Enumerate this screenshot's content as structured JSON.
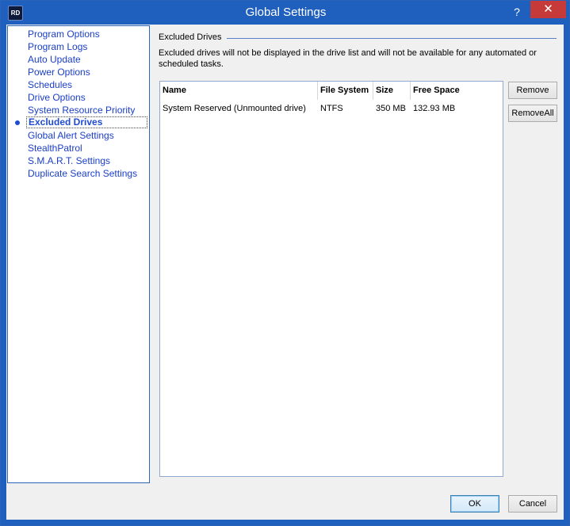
{
  "window": {
    "title": "Global Settings",
    "app_icon_text": "RD",
    "help_glyph": "?",
    "close_glyph": "✕"
  },
  "sidebar": {
    "items": [
      {
        "label": "Program Options",
        "selected": false
      },
      {
        "label": "Program Logs",
        "selected": false
      },
      {
        "label": "Auto Update",
        "selected": false
      },
      {
        "label": "Power Options",
        "selected": false
      },
      {
        "label": "Schedules",
        "selected": false
      },
      {
        "label": "Drive Options",
        "selected": false
      },
      {
        "label": "System Resource Priority",
        "selected": false
      },
      {
        "label": "Excluded Drives",
        "selected": true
      },
      {
        "label": "Global Alert Settings",
        "selected": false
      },
      {
        "label": "StealthPatrol",
        "selected": false
      },
      {
        "label": "S.M.A.R.T. Settings",
        "selected": false
      },
      {
        "label": "Duplicate Search Settings",
        "selected": false
      }
    ]
  },
  "panel": {
    "group_title": "Excluded Drives",
    "description": "Excluded drives will not be displayed in the drive list and will not be available for any automated or scheduled tasks.",
    "columns": [
      "Name",
      "File System",
      "Size",
      "Free Space"
    ],
    "rows": [
      {
        "name": "System Reserved (Unmounted drive)",
        "file_system": "NTFS",
        "size": "350 MB",
        "free_space": "132.93 MB"
      }
    ],
    "remove_label": "Remove",
    "remove_all_label": "RemoveAll"
  },
  "footer": {
    "ok_label": "OK",
    "cancel_label": "Cancel"
  },
  "colors": {
    "title_bar": "#1f5fbd",
    "close_button": "#c73a3a",
    "link_blue": "#1a3ec7"
  }
}
